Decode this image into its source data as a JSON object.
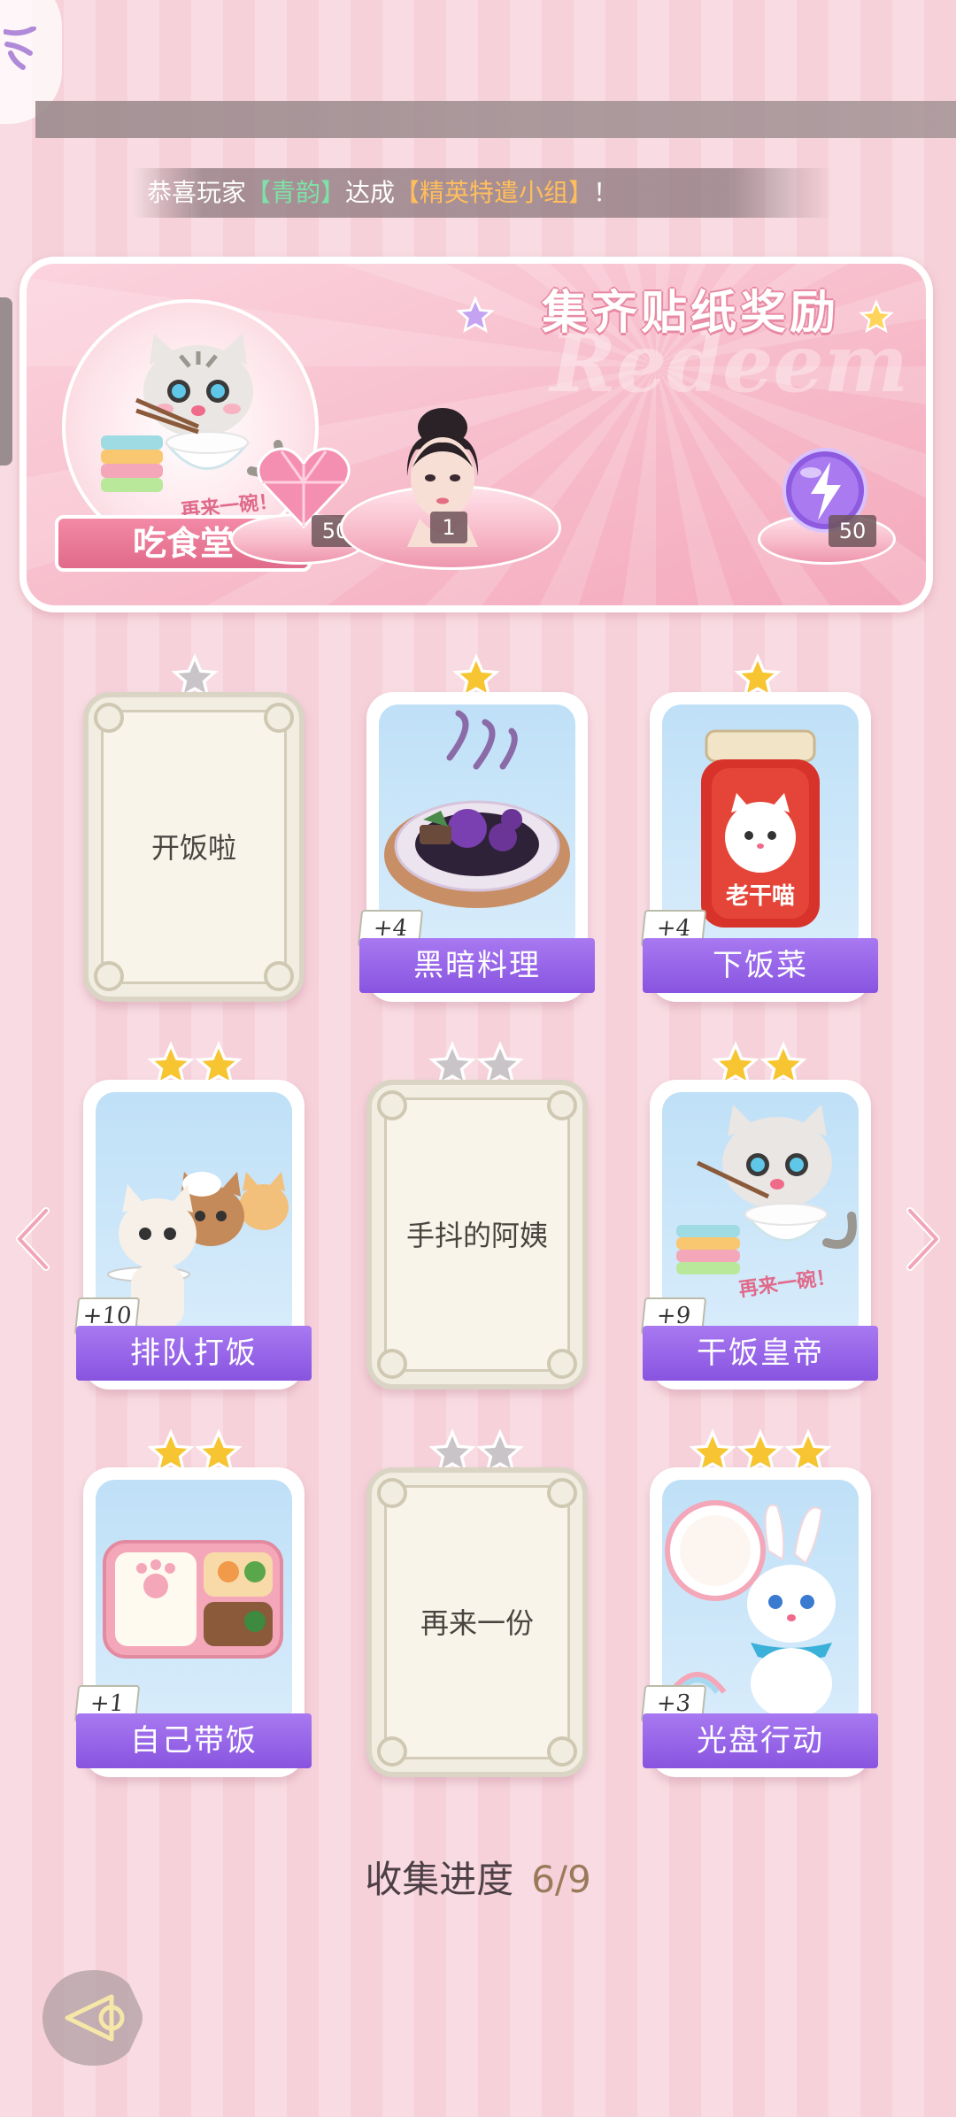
{
  "broadcast": {
    "prefix": "恭喜玩家",
    "player": "【青韵】",
    "middle": "达成",
    "achievement": "【精英特遣小组】",
    "suffix": "！"
  },
  "reward_panel": {
    "title": "集齐贴纸奖励",
    "watermark": "Redeem",
    "set_name": "吃食堂",
    "set_art_caption": "再来一碗！",
    "rewards": [
      {
        "icon": "pink-heart-gem-icon",
        "count": "50"
      },
      {
        "icon": "character-portrait",
        "count": "1"
      },
      {
        "icon": "purple-lightning-orb-icon",
        "count": "50"
      }
    ]
  },
  "cards": [
    {
      "name": "开饭啦",
      "stars": 1,
      "locked": true,
      "plus": ""
    },
    {
      "name": "黑暗料理",
      "stars": 1,
      "locked": false,
      "plus": "+4",
      "art": "dark-cuisine-art"
    },
    {
      "name": "下饭菜",
      "stars": 1,
      "locked": false,
      "plus": "+4",
      "art": "chili-jar-art",
      "jar_label": "老干喵"
    },
    {
      "name": "排队打饭",
      "stars": 2,
      "locked": false,
      "plus": "+10",
      "art": "queue-cats-art"
    },
    {
      "name": "手抖的阿姨",
      "stars": 2,
      "locked": true,
      "plus": ""
    },
    {
      "name": "干饭皇帝",
      "stars": 2,
      "locked": false,
      "plus": "+9",
      "art": "rice-cat-art",
      "caption": "再来一碗！"
    },
    {
      "name": "自己带饭",
      "stars": 2,
      "locked": false,
      "plus": "+1",
      "art": "bento-box-art"
    },
    {
      "name": "再来一份",
      "stars": 2,
      "locked": true,
      "plus": ""
    },
    {
      "name": "光盘行动",
      "stars": 3,
      "locked": false,
      "plus": "+3",
      "art": "bunny-plate-art"
    }
  ],
  "star_colors": {
    "earned": "#f7c531",
    "unearned": "#c9c4c8"
  },
  "progress": {
    "label": "收集进度",
    "value": "6/9"
  }
}
